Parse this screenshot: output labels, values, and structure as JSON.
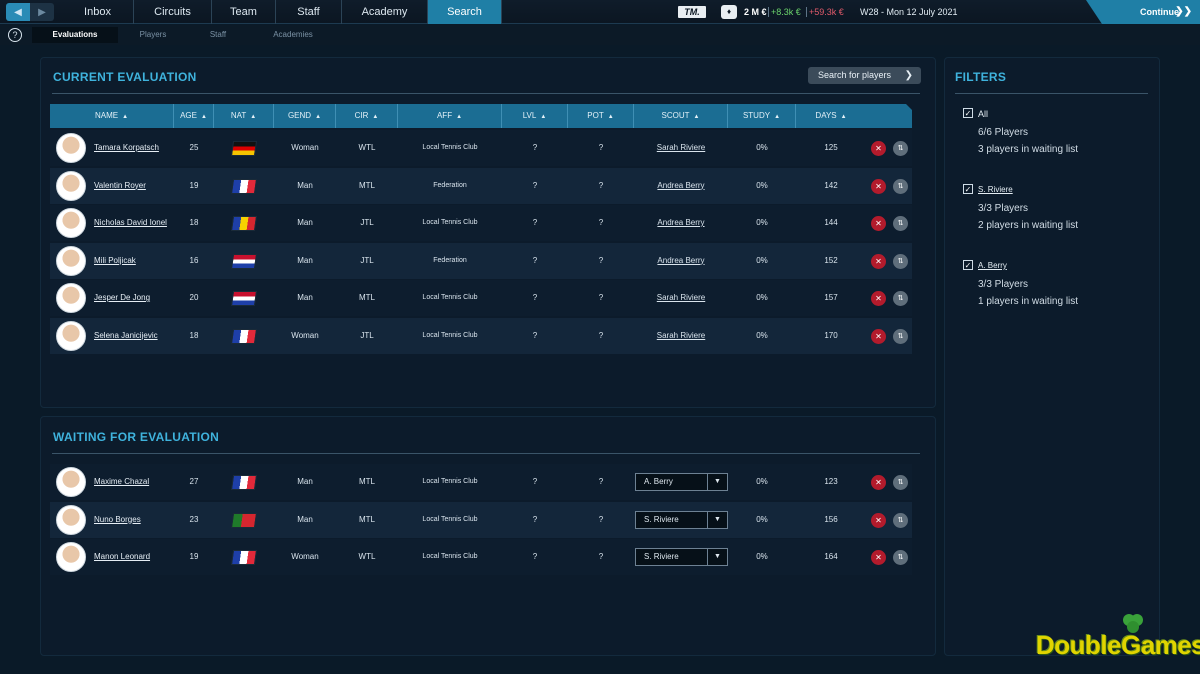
{
  "topbar": {
    "tabs": [
      "Inbox",
      "Circuits",
      "Team",
      "Staff",
      "Academy",
      "Search"
    ],
    "active_tab": "Search",
    "logo": "TM.",
    "money": "2 M €",
    "gain": "+8.3k €",
    "loss": "+59.3k €",
    "date": "W28 - Mon 12 July 2021",
    "continue_label": "Continue",
    "accent": "#1f7fa6"
  },
  "subnav": {
    "tabs": [
      "Evaluations",
      "Players",
      "Staff",
      "Academies"
    ],
    "active": "Evaluations"
  },
  "current": {
    "title": "CURRENT EVALUATION",
    "search_button": "Search for players"
  },
  "columns": [
    "NAME",
    "AGE",
    "NAT",
    "GEND",
    "CIR",
    "AFF",
    "LVL",
    "POT",
    "SCOUT",
    "STUDY",
    "DAYS"
  ],
  "current_rows": [
    {
      "name": "Tamara Korpatsch",
      "age": "25",
      "flag": "de",
      "gender": "Woman",
      "cir": "WTL",
      "aff": "Local Tennis Club",
      "lvl": "?",
      "pot": "?",
      "scout": "Sarah Riviere",
      "study": "0%",
      "days": "125"
    },
    {
      "name": "Valentin Royer",
      "age": "19",
      "flag": "fr",
      "gender": "Man",
      "cir": "MTL",
      "aff": "Federation",
      "lvl": "?",
      "pot": "?",
      "scout": "Andrea Berry",
      "study": "0%",
      "days": "142"
    },
    {
      "name": "Nicholas David Ionel",
      "age": "18",
      "flag": "ro",
      "gender": "Man",
      "cir": "JTL",
      "aff": "Local Tennis Club",
      "lvl": "?",
      "pot": "?",
      "scout": "Andrea Berry",
      "study": "0%",
      "days": "144"
    },
    {
      "name": "Mili Poljicak",
      "age": "16",
      "flag": "nl",
      "gender": "Man",
      "cir": "JTL",
      "aff": "Federation",
      "lvl": "?",
      "pot": "?",
      "scout": "Andrea Berry",
      "study": "0%",
      "days": "152"
    },
    {
      "name": "Jesper De Jong",
      "age": "20",
      "flag": "nl",
      "gender": "Man",
      "cir": "MTL",
      "aff": "Local Tennis Club",
      "lvl": "?",
      "pot": "?",
      "scout": "Sarah Riviere",
      "study": "0%",
      "days": "157"
    },
    {
      "name": "Selena Janicijevic",
      "age": "18",
      "flag": "fr",
      "gender": "Woman",
      "cir": "JTL",
      "aff": "Local Tennis Club",
      "lvl": "?",
      "pot": "?",
      "scout": "Sarah Riviere",
      "study": "0%",
      "days": "170"
    }
  ],
  "waiting": {
    "title": "WAITING FOR EVALUATION"
  },
  "waiting_rows": [
    {
      "name": "Maxime Chazal",
      "age": "27",
      "flag": "fr",
      "gender": "Man",
      "cir": "MTL",
      "aff": "Local Tennis Club",
      "lvl": "?",
      "pot": "?",
      "scout": "A. Berry",
      "study": "0%",
      "days": "123"
    },
    {
      "name": "Nuno Borges",
      "age": "23",
      "flag": "pt",
      "gender": "Man",
      "cir": "MTL",
      "aff": "Local Tennis Club",
      "lvl": "?",
      "pot": "?",
      "scout": "S. Riviere",
      "study": "0%",
      "days": "156"
    },
    {
      "name": "Manon Leonard",
      "age": "19",
      "flag": "fr",
      "gender": "Woman",
      "cir": "WTL",
      "aff": "Local Tennis Club",
      "lvl": "?",
      "pot": "?",
      "scout": "S. Riviere",
      "study": "0%",
      "days": "164"
    }
  ],
  "filters": {
    "title": "FILTERS",
    "groups": [
      {
        "label": "All",
        "players": "6/6 Players",
        "waiting": "3 players in waiting list"
      },
      {
        "label": "S. Riviere",
        "players": "3/3 Players",
        "waiting": "2 players in waiting list"
      },
      {
        "label": "A. Berry",
        "players": "3/3 Players",
        "waiting": "1 players in waiting list"
      }
    ]
  },
  "watermark": "DoubleGames"
}
